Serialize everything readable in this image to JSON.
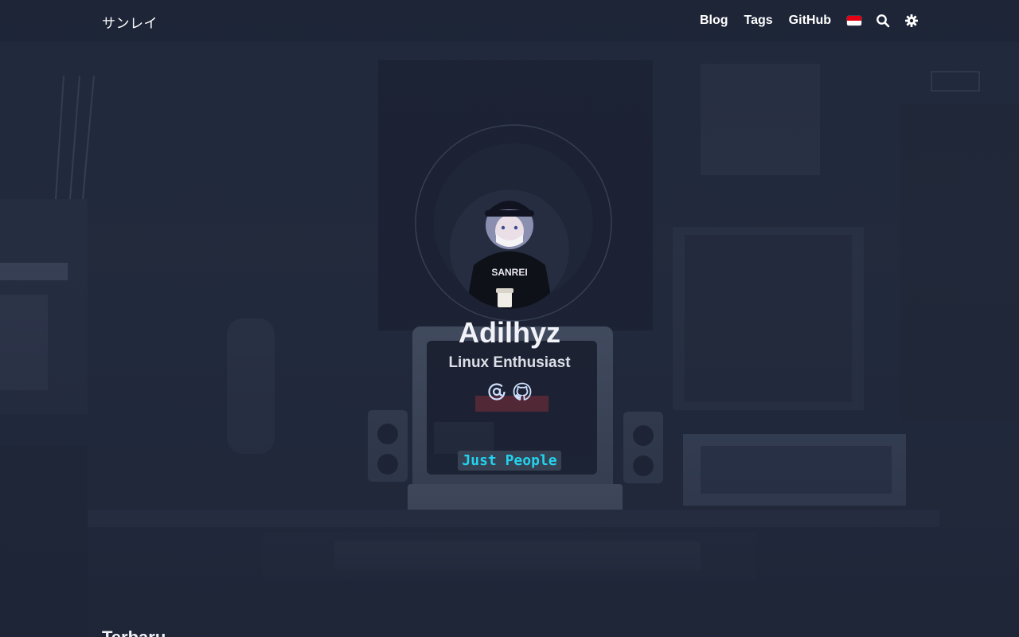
{
  "header": {
    "logo": "サンレイ",
    "nav": [
      {
        "label": "Blog"
      },
      {
        "label": "Tags"
      },
      {
        "label": "GitHub"
      }
    ],
    "language_flag": "indonesia-flag-icon",
    "search_icon": "search-icon",
    "theme_icon": "gear-icon"
  },
  "profile": {
    "name": "Adilhyz",
    "subtitle": "Linux Enthusiast",
    "avatar_text": "SANREI",
    "social_icons": [
      "email-at-icon",
      "github-icon"
    ],
    "tag": "Just People"
  },
  "section": {
    "title": "Terbaru"
  },
  "colors": {
    "background": "#1e2537",
    "accent": "#22d3ee",
    "text": "#f1f3f8"
  }
}
